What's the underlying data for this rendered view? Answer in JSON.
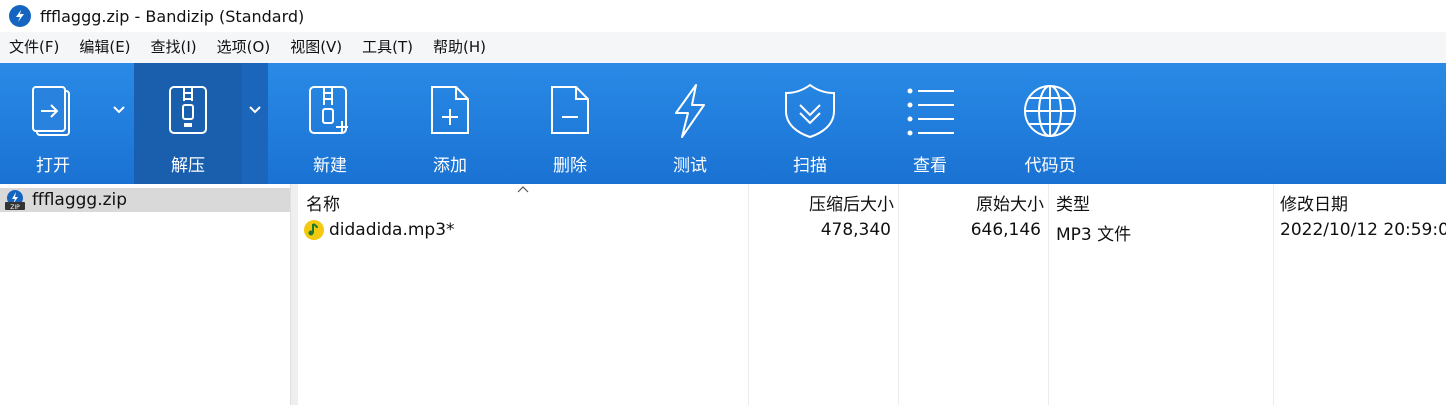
{
  "window": {
    "title": "ffflaggg.zip - Bandizip (Standard)"
  },
  "menu": [
    "文件(F)",
    "编辑(E)",
    "查找(I)",
    "选项(O)",
    "视图(V)",
    "工具(T)",
    "帮助(H)"
  ],
  "toolbar": {
    "open": "打开",
    "extract": "解压",
    "new": "新建",
    "add": "添加",
    "delete": "删除",
    "test": "测试",
    "scan": "扫描",
    "view": "查看",
    "codepage": "代码页"
  },
  "tree": {
    "root": "ffflaggg.zip"
  },
  "columns": {
    "name": "名称",
    "compressed": "压缩后大小",
    "original": "原始大小",
    "type": "类型",
    "modified": "修改日期"
  },
  "files": [
    {
      "name": "didadida.mp3*",
      "compressed": "478,340",
      "original": "646,146",
      "type": "MP3 文件",
      "modified": "2022/10/12 20:59:0"
    }
  ],
  "colors": {
    "toolbar": "#1a72d3",
    "selected_tree": "#d9d9d9"
  }
}
